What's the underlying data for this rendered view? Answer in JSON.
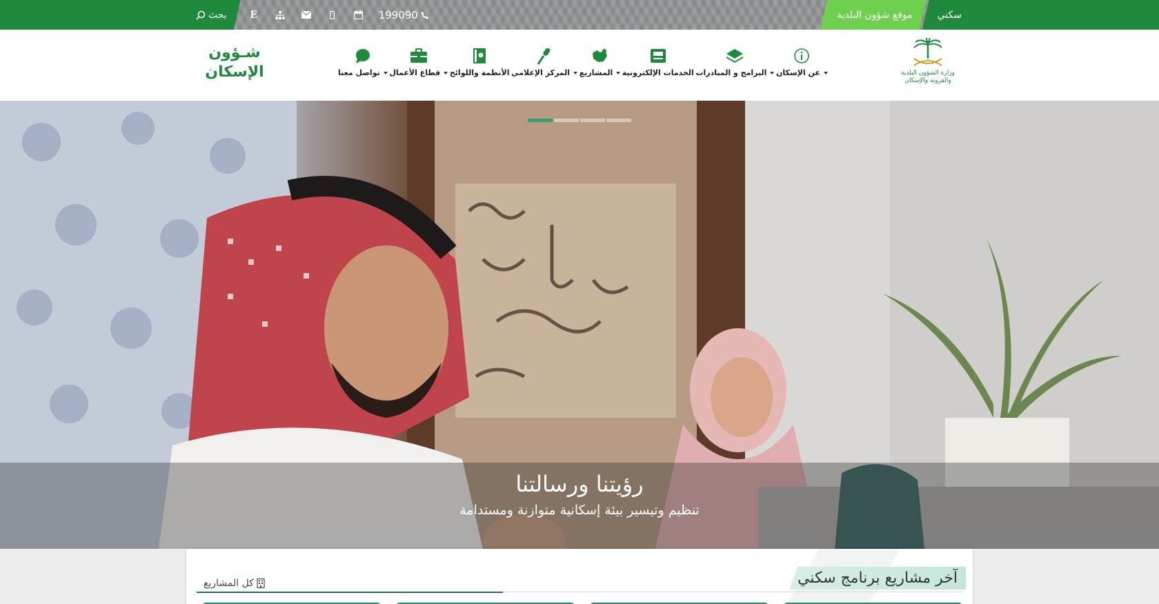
{
  "topbar": {
    "sakani_label": "سكني",
    "municipal_site_label": "موقع شؤون البلدية",
    "search_label": "بحث",
    "english_label": "E",
    "phone": "199090"
  },
  "header": {
    "ministry_name": "وزارة الشؤون البلدية والقروية والإسكان",
    "brand_line1": "شـؤون",
    "brand_line2": "الإسكان"
  },
  "nav": {
    "items": [
      {
        "label": "عن الإسكان",
        "icon": "info-icon",
        "dropdown": true
      },
      {
        "label": "البرامج و المبادرات",
        "icon": "layers-icon",
        "dropdown": true
      },
      {
        "label": "الخدمات الإلكترونية",
        "icon": "eservices-icon",
        "dropdown": false
      },
      {
        "label": "المشاريع",
        "icon": "map-icon",
        "dropdown": true
      },
      {
        "label": "المركز الإعلامي",
        "icon": "microphone-icon",
        "dropdown": true
      },
      {
        "label": "الأنظمة واللوائح",
        "icon": "book-icon",
        "dropdown": false
      },
      {
        "label": "قطاع الأعمال",
        "icon": "briefcase-icon",
        "dropdown": true
      },
      {
        "label": "تواصل معنا",
        "icon": "chat-icon",
        "dropdown": true
      }
    ]
  },
  "hero": {
    "title": "رؤيتنا ورسالتنا",
    "subtitle": "تنظيم وتيسير بيئة إسكانية متوازنة ومستدامة",
    "slide_count": 4,
    "active_slide": 1
  },
  "projects": {
    "title": "آخر مشاريع برنامج سكني",
    "all_label": "كل المشاريع"
  },
  "colors": {
    "brand_green": "#1f8a3c",
    "light_green": "#6fcf4f",
    "indicator_active": "#3a9b77"
  }
}
